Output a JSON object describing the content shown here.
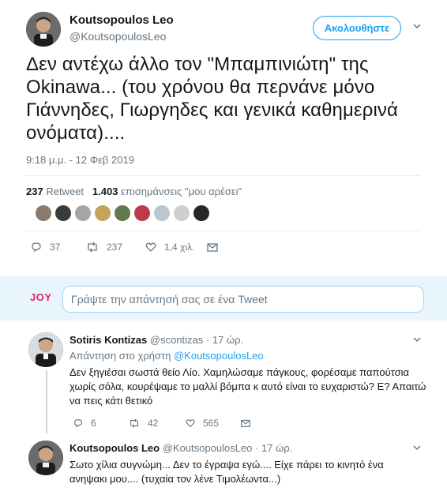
{
  "main_tweet": {
    "author_name": "Koutsopoulos Leo",
    "author_handle": "@KoutsopoulosLeo",
    "follow_label": "Ακολουθήστε",
    "text": "Δεν αντέχω άλλο τον \"Μπαμπινιώτη\" της Okinawa... (του χρόνου θα περνάνε μόνο Γιάννηδες, Γιωργηδες και γενικά καθημερινά ονόματα)....",
    "timestamp": "9:18 μ.μ. - 12 Φεβ 2019",
    "retweet_count": "237",
    "retweet_label": "Retweet",
    "like_count": "1.403",
    "like_label": "επισημάνσεις \"μου αρέσει\"",
    "actions": {
      "replies": "37",
      "retweets": "237",
      "likes": "1,4 χιλ."
    }
  },
  "reply_composer": {
    "brand": "JOY",
    "placeholder": "Γράψτε την απάντησή σας σε ένα Tweet"
  },
  "replies": [
    {
      "author_name": "Sotiris Kontizas",
      "author_handle": "@scontizas",
      "time": "17 ώρ.",
      "reply_to_prefix": "Απάντηση στο χρήστη",
      "reply_to_handle": "@KoutsopoulosLeo",
      "text": "Δεν ξηγιέσαι σωστά θείο Λίο. Χαμηλώσαμε πάγκους, φορέσαμε παπούτσια χωρίς σόλα, κουρέψαμε το μαλλί βόμπα κ αυτό είναι το ευχαριστώ? Ε? Απαιτώ να πεις κάτι θετικό",
      "actions": {
        "replies": "6",
        "retweets": "42",
        "likes": "565"
      }
    },
    {
      "author_name": "Koutsopoulos Leo",
      "author_handle": "@KoutsopoulosLeo",
      "time": "17 ώρ.",
      "text": "Σωτο χίλια συγνώμη... Δεν το έγραψα εγώ.... Είχε πάρει το κινητό ένα ανηψακι μου.... (τυχαία τον λένε Τιμολέωντα...)"
    }
  ],
  "colors": {
    "accent": "#1da1f2",
    "muted": "#657786",
    "band": "#e8f5fd",
    "joy": "#e0245e"
  }
}
